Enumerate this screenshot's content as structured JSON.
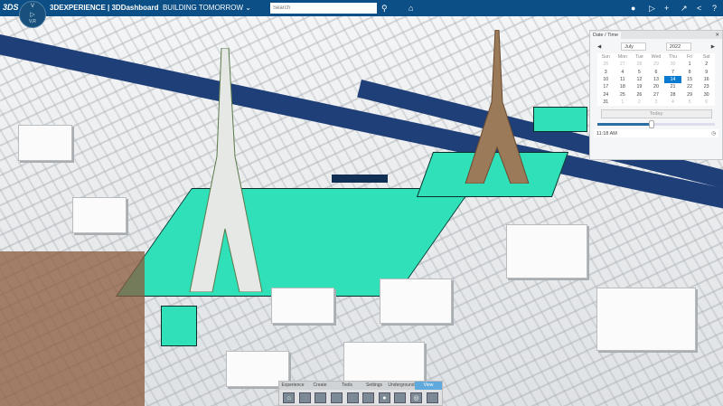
{
  "topbar": {
    "logo": "3DS",
    "title_brand": "3DEXPERIENCE | 3DDashboard",
    "dashboard": "BUILDING TOMORROW",
    "search_placeholder": "Search",
    "compass": {
      "top": "V",
      "left": "",
      "play": "▷",
      "bottom": "V,R"
    }
  },
  "datetime": {
    "title": "Date / Time",
    "month": "July",
    "year": "2022",
    "weekdays": [
      "Sun",
      "Mon",
      "Tue",
      "Wed",
      "Thu",
      "Fri",
      "Sat"
    ],
    "weeks": [
      [
        "26",
        "27",
        "28",
        "29",
        "30",
        "1",
        "2"
      ],
      [
        "3",
        "4",
        "5",
        "6",
        "7",
        "8",
        "9"
      ],
      [
        "10",
        "11",
        "12",
        "13",
        "14",
        "15",
        "16"
      ],
      [
        "17",
        "18",
        "19",
        "20",
        "21",
        "22",
        "23"
      ],
      [
        "24",
        "25",
        "26",
        "27",
        "28",
        "29",
        "30"
      ],
      [
        "31",
        "1",
        "2",
        "3",
        "4",
        "5",
        "6"
      ]
    ],
    "selected_day": "14",
    "today_label": "Today",
    "time": "11:18 AM",
    "slider_fraction": 0.46
  },
  "toolbar": {
    "tabs": [
      "Experience",
      "Create",
      "Tools",
      "Settings",
      "Underground",
      "View"
    ],
    "active_tab": "View"
  },
  "colors": {
    "topbar": "#0b4f86",
    "park": "#2fe0b8",
    "river": "#1f3f78",
    "accent": "#0a7bd1"
  }
}
